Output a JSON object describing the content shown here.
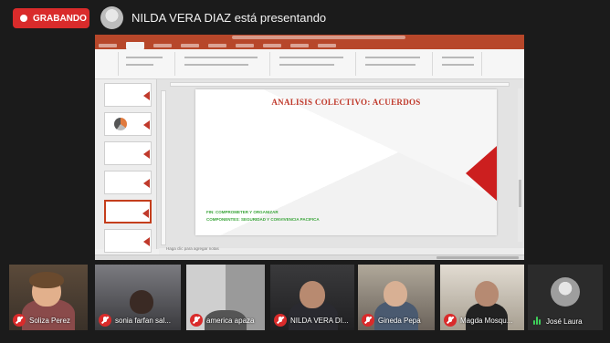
{
  "top_bar": {
    "record_label": "GRABANDO",
    "presenter_text": "NILDA VERA DIAZ está presentando"
  },
  "shared_screen": {
    "app": "PowerPoint",
    "slide": {
      "title": "ANALISIS COLECTIVO: ACUERDOS",
      "line1": "FIN: COMPROMETER Y ORGANIZAR",
      "line2": "COMPONENTES: SEGURIDAD Y CONVIVENCIA PACIFICA"
    },
    "notes_placeholder": "Haga clic para agregar notas",
    "accent_color": "#c0392b",
    "text_color_green": "#3aa53a"
  },
  "participants": [
    {
      "name": "Soliza Perez",
      "muted": true
    },
    {
      "name": "sonia farfan sal...",
      "muted": true
    },
    {
      "name": "america apaza",
      "muted": true
    },
    {
      "name": "NILDA VERA DI...",
      "muted": true
    },
    {
      "name": "Gineda Pepa",
      "muted": true
    },
    {
      "name": "Magda Mosqu...",
      "muted": true
    },
    {
      "name": "José Laura",
      "muted": false
    }
  ],
  "colors": {
    "record_red": "#d92b2b",
    "background": "#1b1b1b",
    "speaking_green": "#3ecf5a"
  }
}
